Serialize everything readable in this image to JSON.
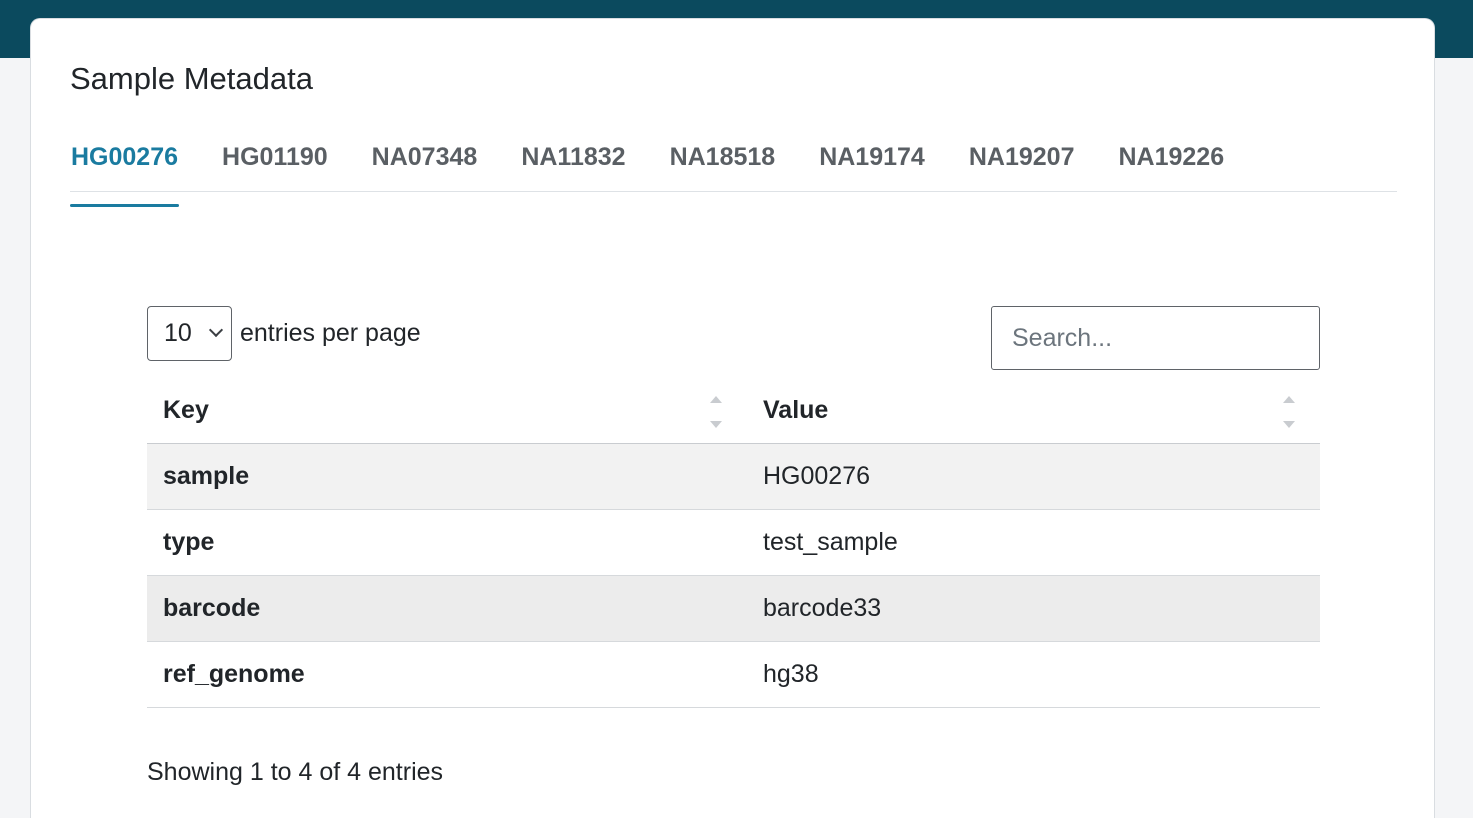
{
  "card": {
    "title": "Sample Metadata"
  },
  "tabs": [
    {
      "label": "HG00276",
      "active": true
    },
    {
      "label": "HG01190",
      "active": false
    },
    {
      "label": "NA07348",
      "active": false
    },
    {
      "label": "NA11832",
      "active": false
    },
    {
      "label": "NA18518",
      "active": false
    },
    {
      "label": "NA19174",
      "active": false
    },
    {
      "label": "NA19207",
      "active": false
    },
    {
      "label": "NA19226",
      "active": false
    }
  ],
  "controls": {
    "page_length": "10",
    "page_length_label": "entries per page",
    "search_placeholder": "Search..."
  },
  "table": {
    "headers": [
      "Key",
      "Value"
    ],
    "rows": [
      {
        "key": "sample",
        "value": "HG00276"
      },
      {
        "key": "type",
        "value": "test_sample"
      },
      {
        "key": "barcode",
        "value": "barcode33"
      },
      {
        "key": "ref_genome",
        "value": "hg38"
      }
    ]
  },
  "info": "Showing 1 to 4 of 4 entries",
  "colors": {
    "header_band": "#0b4a5e",
    "accent": "#1a7ba0"
  }
}
